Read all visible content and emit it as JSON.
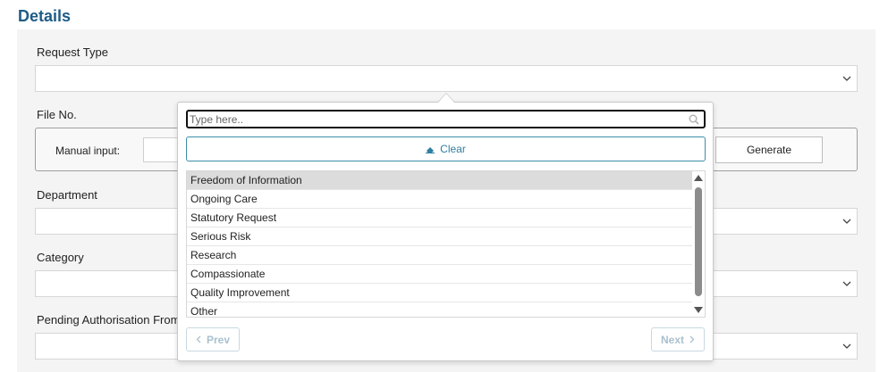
{
  "section": {
    "title": "Details"
  },
  "fields": {
    "request_type": {
      "label": "Request Type"
    },
    "file_no": {
      "label": "File No.",
      "manual_label": "Manual input:",
      "generate_label": "Generate"
    },
    "department": {
      "label": "Department"
    },
    "category": {
      "label": "Category"
    },
    "pending_authorisation": {
      "label": "Pending Authorisation From"
    }
  },
  "dropdown": {
    "search_placeholder": "Type here..",
    "clear_label": "Clear",
    "options": [
      "Freedom of Information",
      "Ongoing Care",
      "Statutory Request",
      "Serious Risk",
      "Research",
      "Compassionate",
      "Quality Improvement",
      "Other"
    ],
    "active_option": "Freedom of Information",
    "prev_label": "Prev",
    "next_label": "Next"
  },
  "colors": {
    "title": "#1d5c86",
    "accent": "#2e7fa0",
    "disabled": "#a9c1cf"
  }
}
